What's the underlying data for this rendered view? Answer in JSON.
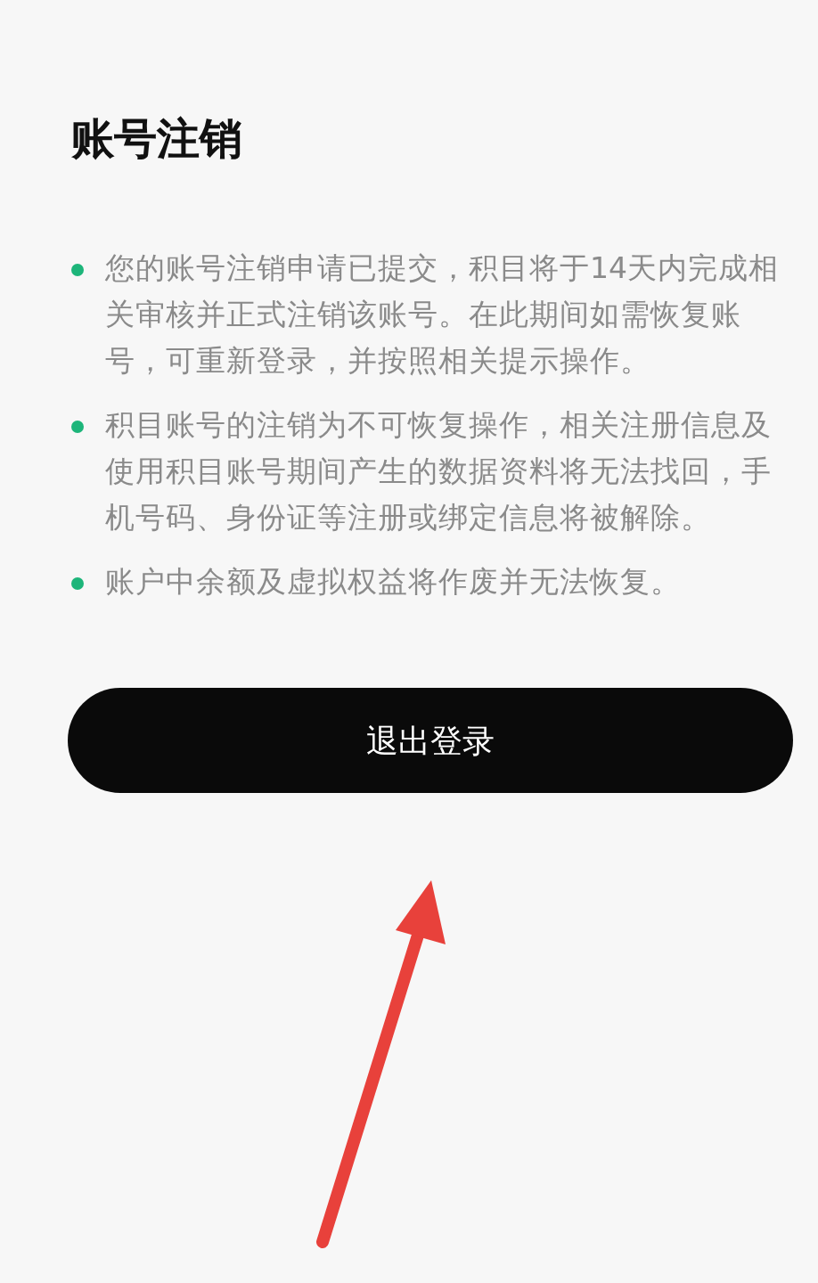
{
  "title": "账号注销",
  "notes": [
    {
      "text": "您的账号注销申请已提交，积目将于14天内完成相关审核并正式注销该账号。在此期间如需恢复账号，可重新登录，并按照相关提示操作。",
      "color": "#1db57a"
    },
    {
      "text": "积目账号的注销为不可恢复操作，相关注册信息及使用积目账号期间产生的数据资料将无法找回，手机号码、身份证等注册或绑定信息将被解除。",
      "color": "#1db57a"
    },
    {
      "text": "账户中余额及虚拟权益将作废并无法恢复。",
      "color": "#1db57a"
    }
  ],
  "button": {
    "label": "退出登录"
  }
}
